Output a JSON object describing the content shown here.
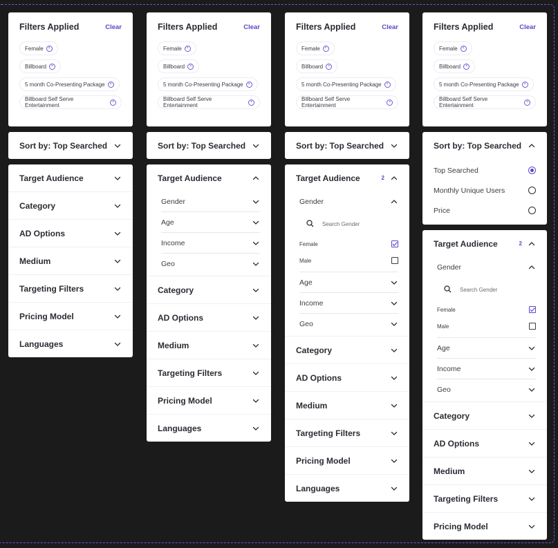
{
  "filters": {
    "title": "Filters Applied",
    "clear_label": "Clear",
    "chips": [
      "Female",
      "Billboard",
      "5 month Co-Presenting Package",
      "Billboard Self Serve Entertainment"
    ]
  },
  "sort": {
    "label": "Sort by: Top Searched",
    "options": [
      {
        "label": "Top Searched",
        "selected": true
      },
      {
        "label": "Monthly Unique Users",
        "selected": false
      },
      {
        "label": "Price",
        "selected": false
      }
    ]
  },
  "sections": [
    "Target Audience",
    "Category",
    "AD Options",
    "Medium",
    "Targeting Filters",
    "Pricing Model",
    "Languages"
  ],
  "target_audience": {
    "badge": "2",
    "subsections": [
      "Gender",
      "Age",
      "Income",
      "Geo"
    ],
    "gender": {
      "search_placeholder": "Search Gender",
      "options": [
        {
          "label": "Female",
          "checked": true
        },
        {
          "label": "Male",
          "checked": false
        }
      ]
    }
  },
  "colors": {
    "accent": "#5b46c9",
    "background": "#1c1b1c",
    "frame": "#7a4fd1"
  }
}
